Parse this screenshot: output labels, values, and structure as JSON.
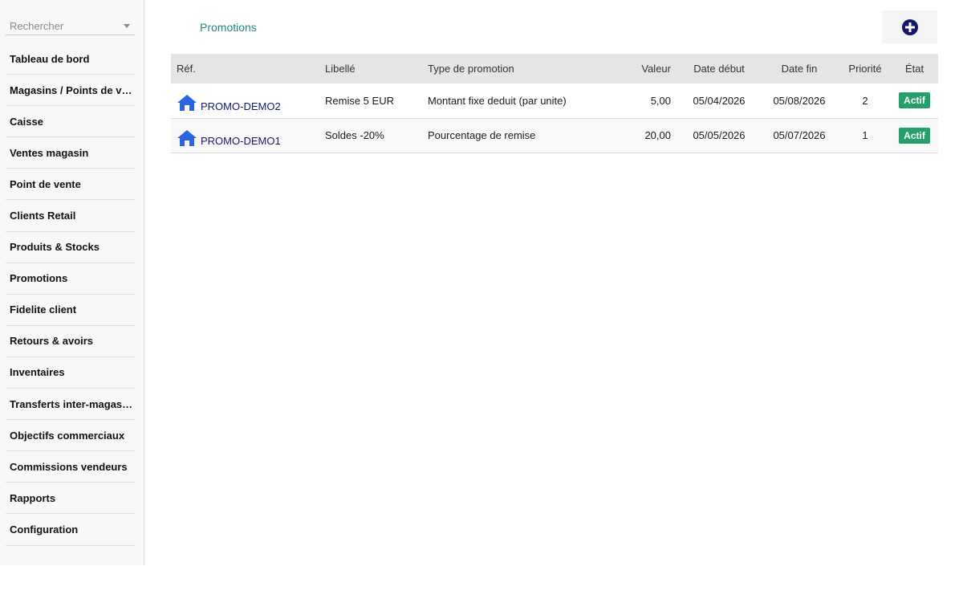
{
  "sidebar": {
    "search": {
      "placeholder": "Rechercher"
    },
    "items": [
      {
        "label": "Tableau de bord"
      },
      {
        "label": "Magasins / Points de vente"
      },
      {
        "label": "Caisse"
      },
      {
        "label": "Ventes magasin"
      },
      {
        "label": "Point de vente"
      },
      {
        "label": "Clients Retail"
      },
      {
        "label": "Produits & Stocks"
      },
      {
        "label": "Promotions"
      },
      {
        "label": "Fidelite client"
      },
      {
        "label": "Retours & avoirs"
      },
      {
        "label": "Inventaires"
      },
      {
        "label": "Transferts inter-magasins"
      },
      {
        "label": "Objectifs commerciaux"
      },
      {
        "label": "Commissions vendeurs"
      },
      {
        "label": "Rapports"
      },
      {
        "label": "Configuration"
      }
    ]
  },
  "header": {
    "title": "Promotions",
    "add_icon": "plus-circle-icon"
  },
  "table": {
    "columns": {
      "ref": "Réf.",
      "libelle": "Libellé",
      "type": "Type de promotion",
      "valeur": "Valeur",
      "date_debut": "Date début",
      "date_fin": "Date fin",
      "priorite": "Priorité",
      "etat": "État"
    },
    "rows": [
      {
        "icon": "house-icon",
        "ref": "PROMO-DEMO2",
        "libelle": "Remise 5 EUR",
        "type": "Montant fixe deduit (par unite)",
        "valeur": "5,00",
        "date_debut": "05/04/2026",
        "date_fin": "05/08/2026",
        "priorite": "2",
        "etat": "Actif"
      },
      {
        "icon": "house-icon",
        "ref": "PROMO-DEMO1",
        "libelle": "Soldes -20%",
        "type": "Pourcentage de remise",
        "valeur": "20,00",
        "date_debut": "05/05/2026",
        "date_fin": "05/07/2026",
        "priorite": "1",
        "etat": "Actif"
      }
    ]
  },
  "colors": {
    "title": "#1f8a83",
    "badge": "#25a06d",
    "link": "#14176b",
    "house_icon": "#2a64e0",
    "add_icon": "#14176b"
  }
}
